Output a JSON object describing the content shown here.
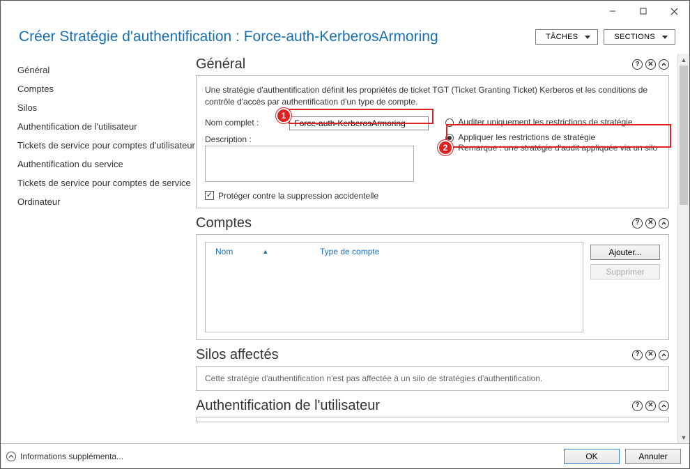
{
  "window": {
    "title": "Créer Stratégie d'authentification : Force-auth-KerberosArmoring"
  },
  "header": {
    "tasks": "TÂCHES",
    "sections": "SECTIONS"
  },
  "sidebar": {
    "items": [
      {
        "label": "Général"
      },
      {
        "label": "Comptes"
      },
      {
        "label": "Silos"
      },
      {
        "label": "Authentification de l'utilisateur"
      },
      {
        "label": "Tickets de service pour comptes d'utilisateur"
      },
      {
        "label": "Authentification du service"
      },
      {
        "label": "Tickets de service pour comptes de service"
      },
      {
        "label": "Ordinateur"
      }
    ]
  },
  "general": {
    "title": "Général",
    "desc": "Une stratégie d'authentification définit les propriétés de ticket TGT (Ticket Granting Ticket) Kerberos et les conditions de contrôle d'accès par authentification d'un type de compte.",
    "name_label": "Nom complet :",
    "name_value": "Force-auth-KerberosArmoring",
    "desc_label": "Description :",
    "desc_value": "",
    "radio_audit": "Auditer uniquement les restrictions de stratégie",
    "radio_apply": "Appliquer les restrictions de stratégie",
    "note": "Remarque : une stratégie d'audit appliquée via un silo",
    "protect": "Protéger contre la suppression accidentelle",
    "protect_checked": true
  },
  "accounts": {
    "title": "Comptes",
    "col_name": "Nom",
    "col_type": "Type de compte",
    "btn_add": "Ajouter...",
    "btn_remove": "Supprimer"
  },
  "silos": {
    "title": "Silos affectés",
    "text": "Cette stratégie d'authentification n'est pas affectée à un silo de stratégies d'authentification."
  },
  "auth": {
    "title": "Authentification de l'utilisateur"
  },
  "footer": {
    "info": "Informations supplémenta...",
    "ok": "OK",
    "cancel": "Annuler"
  },
  "callouts": {
    "n1": "1",
    "n2": "2"
  }
}
